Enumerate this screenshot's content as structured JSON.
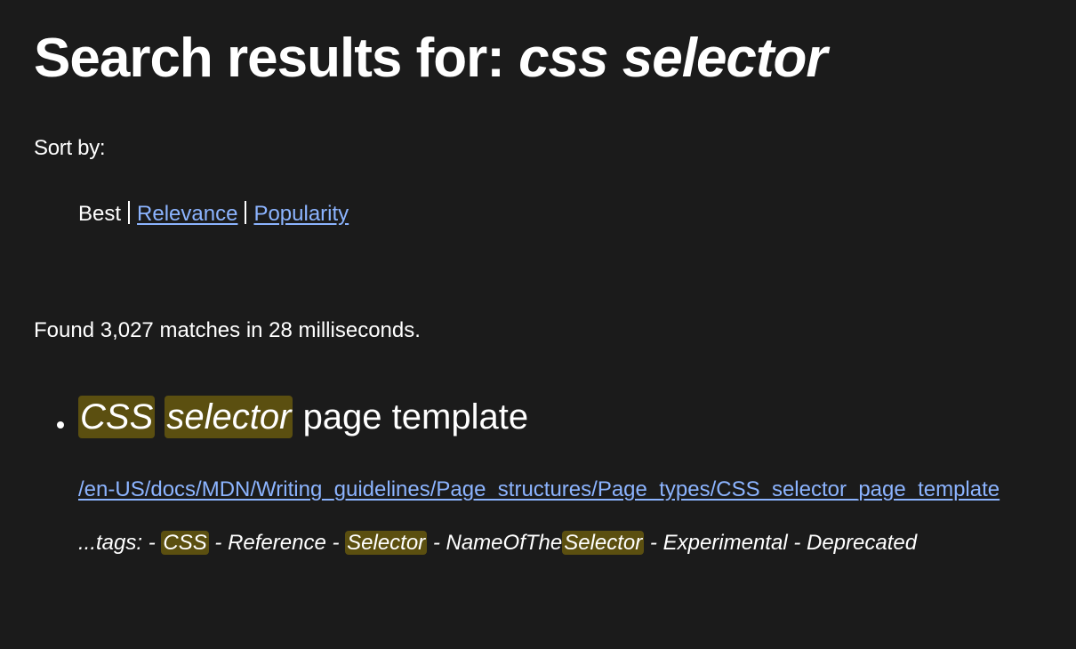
{
  "header": {
    "title_prefix": "Search results for:",
    "query": "css selector"
  },
  "sort": {
    "label": "Sort by:",
    "options": [
      {
        "label": "Best",
        "active": true
      },
      {
        "label": "Relevance",
        "active": false
      },
      {
        "label": "Popularity",
        "active": false
      }
    ]
  },
  "summary": {
    "text": "Found 3,027 matches in 28 milliseconds."
  },
  "results": [
    {
      "title_parts": {
        "hl1": "CSS",
        "hl2": "selector",
        "rest": "page template"
      },
      "url": "/en-US/docs/MDN/Writing_guidelines/Page_structures/Page_types/CSS_selector_page_template",
      "excerpt_parts": {
        "p1": "...tags: - ",
        "h1": "CSS",
        "p2": " - Reference - ",
        "h2": "Selector",
        "p3": " - NameOfThe",
        "h3": "Selector",
        "p4": " - Experimental - Deprecated"
      }
    }
  ],
  "colors": {
    "background": "#1b1b1b",
    "text": "#ffffff",
    "link": "#8cb4ff",
    "highlight": "#5b4f10"
  }
}
